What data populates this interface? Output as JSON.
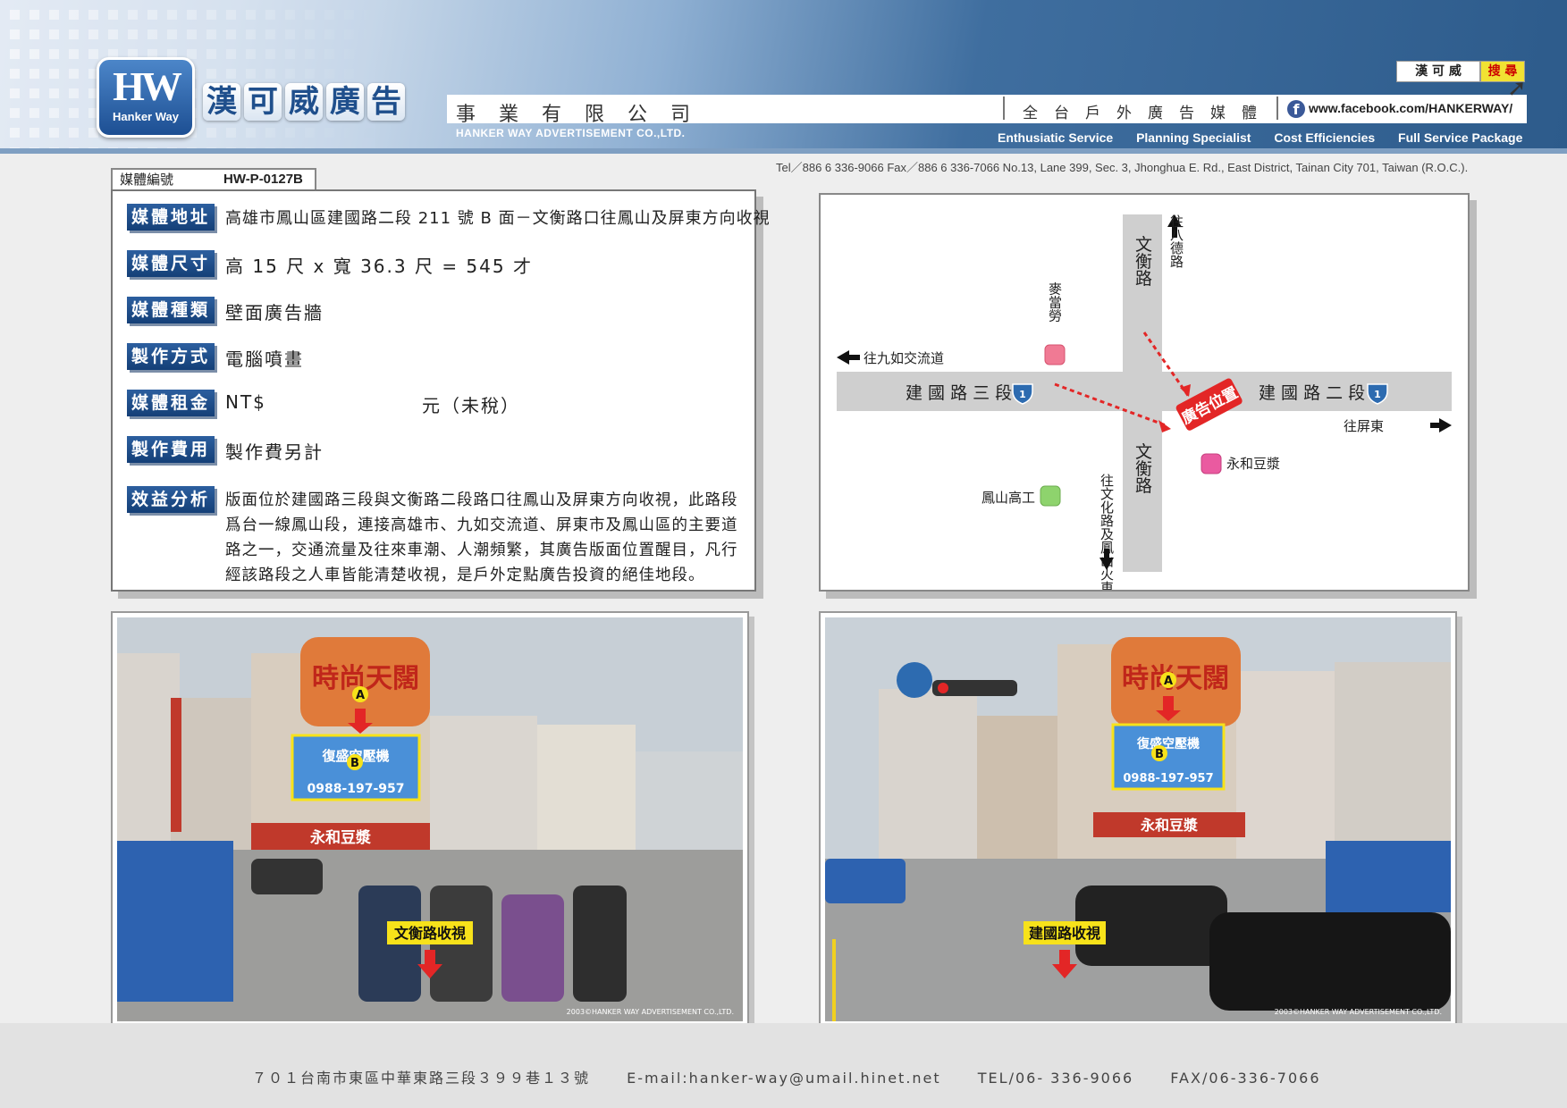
{
  "header": {
    "logo_big": "HW",
    "logo_small": "Hanker Way",
    "brand_chars": [
      "漢",
      "可",
      "威",
      "廣",
      "告"
    ],
    "company": "事業有限公司",
    "company_en": "HANKER WAY ADVERTISEMENT CO.,LTD.",
    "tagline": "全台戶外廣告媒體",
    "facebook_url": "www.facebook.com/HANKERWAY/",
    "services": [
      "Enthusiatic Service",
      "Planning Specialist",
      "Cost Efficiencies",
      "Full Service Package"
    ],
    "search_value": "漢 可 威",
    "search_button": "搜 尋",
    "contact": "Tel／886 6 336-9066   Fax／886 6 336-7066   No.13, Lane 399, Sec. 3, Jhonghua E. Rd., East District, Tainan City 701, Taiwan (R.O.C.)."
  },
  "media_id": {
    "label": "媒體編號",
    "value": "HW-P-0127B"
  },
  "info": {
    "address": {
      "label": "媒體地址",
      "value": "高雄市鳳山區建國路二段 211 號 B 面－文衡路口往鳳山及屏東方向收視"
    },
    "size": {
      "label": "媒體尺寸",
      "value": "高 15 尺 x 寬 36.3 尺 = 545 才"
    },
    "type": {
      "label": "媒體種類",
      "value": "壁面廣告牆"
    },
    "method": {
      "label": "製作方式",
      "value": "電腦噴畫"
    },
    "rent": {
      "label": "媒體租金",
      "value": "NT$",
      "unit": "元（未稅）"
    },
    "cost": {
      "label": "製作費用",
      "value": "製作費另計"
    },
    "analysis": {
      "label": "效益分析",
      "value": "版面位於建國路三段與文衡路二段路口往鳳山及屏東方向收視，此路段爲台一線鳳山段，連接高雄市、九如交流道、屏東市及鳳山區的主要道路之一，交通流量及往來車潮、人潮頻繁，其廣告版面位置醒目，凡行經該路段之人車皆能清楚收視，是戶外定點廣告投資的絕佳地段。"
    }
  },
  "map": {
    "road_west": "建 國 路 三 段",
    "road_east": "建 國 路 二 段",
    "road_north": "文衡路",
    "road_south": "文衡路",
    "dir_north": "往八德路",
    "dir_west": "往九如交流道",
    "dir_east": "往屏東",
    "dir_south": "往文化路及鳳山火車站",
    "landmark_mcd": "麥當勞",
    "landmark_yonghe": "永和豆漿",
    "landmark_school": "鳳山高工",
    "ad_location": "廣告位置",
    "route_badge": "1"
  },
  "photos": {
    "left": {
      "caption": "文衡路收視",
      "copyright": "2003©HANKER WAY ADVERTISEMENT CO.,LTD.",
      "marker_a": "A",
      "marker_b": "B",
      "billboard_top": "時尚天闊",
      "billboard_main": "復盛空壓機",
      "billboard_phone": "0988-197-957",
      "shop_sign": "永和豆漿"
    },
    "right": {
      "caption": "建國路收視",
      "copyright": "2003©HANKER WAY ADVERTISEMENT CO.,LTD.",
      "marker_a": "A",
      "marker_b": "B",
      "billboard_top": "時尚天闊",
      "billboard_main": "復盛空壓機",
      "billboard_phone": "0988-197-957",
      "shop_sign": "永和豆漿"
    }
  },
  "footer": {
    "address": "７０１台南市東區中華東路三段３９９巷１３號",
    "email": "E-mail:hanker-way@umail.hinet.net",
    "tel": "TEL/06- 336-9066",
    "fax": "FAX/06-336-7066"
  },
  "colors": {
    "header_blue": "#2d5b8b",
    "label_blue": "#1f4f8c",
    "accent_red": "#e32626",
    "caption_yellow": "#f7e21a",
    "mcd_pink": "#f07a94",
    "yonghe_pink": "#ea5aa0",
    "school_green": "#8ed36d"
  }
}
